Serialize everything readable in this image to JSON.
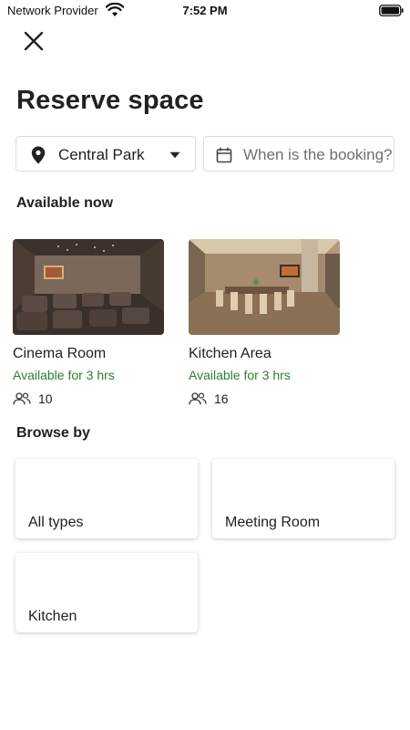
{
  "status_bar": {
    "carrier": "Network Provider",
    "time": "7:52 PM"
  },
  "header": {
    "close_icon": "close-icon",
    "title": "Reserve space"
  },
  "filters": {
    "location": {
      "value": "Central Park",
      "icon": "location-pin-icon"
    },
    "date": {
      "placeholder": "When is the booking?",
      "icon": "calendar-icon"
    }
  },
  "available_now": {
    "title": "Available now",
    "spaces": [
      {
        "name": "Cinema Room",
        "availability": "Available for 3 hrs",
        "capacity": "10"
      },
      {
        "name": "Kitchen Area",
        "availability": "Available for 3 hrs",
        "capacity": "16"
      }
    ]
  },
  "browse_by": {
    "title": "Browse by",
    "types": [
      {
        "label": "All types"
      },
      {
        "label": "Meeting Room"
      },
      {
        "label": "Kitchen"
      }
    ]
  },
  "colors": {
    "availability_text": "#2e7d32",
    "title_text": "#212121",
    "border": "#dcdcdc"
  }
}
